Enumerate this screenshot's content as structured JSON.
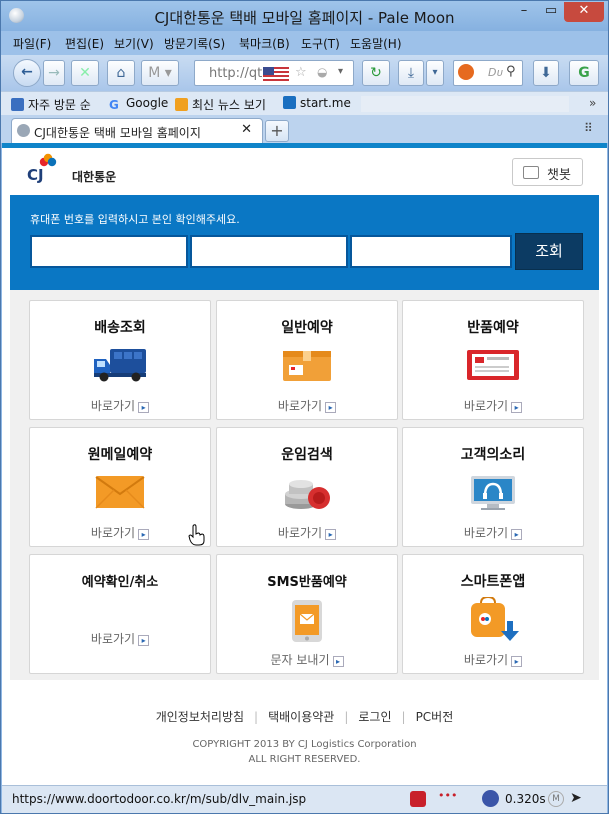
{
  "window": {
    "title": "CJ대한통운 택배 모바일 홈페이지 - Pale Moon"
  },
  "menubar": {
    "items": [
      "파일(F)",
      "편집(E)",
      "보기(V)",
      "방문기록(S)",
      "북마크(B)",
      "도구(T)",
      "도움말(H)"
    ]
  },
  "navbar": {
    "url": "http://qt",
    "search_placeholder": "Dᴜ"
  },
  "bookmarks": {
    "items": [
      "자주 방문 순",
      "Google",
      "최신 뉴스 보기",
      "start.me"
    ]
  },
  "tab": {
    "label": "CJ대한통운 택배 모바일 홈페이지",
    "new_tab": "+"
  },
  "site": {
    "logo_cj": "CJ",
    "logo_name": "대한통운",
    "chatbot_label": "챗봇",
    "lookup_hint": "휴대폰 번호를 입력하시고 본인 확인해주세요.",
    "lookup_button": "조회"
  },
  "cards": [
    {
      "title": "배송조회",
      "link": "바로가기",
      "icon": "delivery-truck-icon"
    },
    {
      "title": "일반예약",
      "link": "바로가기",
      "icon": "parcel-box-icon"
    },
    {
      "title": "반품예약",
      "link": "바로가기",
      "icon": "return-receipt-icon"
    },
    {
      "title": "원메일예약",
      "link": "바로가기",
      "icon": "envelope-icon"
    },
    {
      "title": "운임검색",
      "link": "바로가기",
      "icon": "coins-icon"
    },
    {
      "title": "고객의소리",
      "link": "바로가기",
      "icon": "customer-voice-monitor-icon"
    },
    {
      "title": "예약확인/취소",
      "link": "바로가기",
      "icon": ""
    },
    {
      "title": "SMS반품예약",
      "link": "문자 보내기",
      "icon": "mobile-message-icon"
    },
    {
      "title": "스마트폰앱",
      "link": "바로가기",
      "icon": "app-download-icon"
    }
  ],
  "footer": {
    "links": [
      "개인정보처리방침",
      "택배이용약관",
      "로그인",
      "PC버전"
    ],
    "copyright_1": "COPYRIGHT 2013 BY CJ Logistics Corporation",
    "copyright_2": "ALL RIGHT RESERVED."
  },
  "statusbar": {
    "url": "https://www.doortodoor.co.kr/m/sub/dlv_main.jsp",
    "timing": "0.320s"
  },
  "colors": {
    "accent": "#0a77c4",
    "button": "#0c3b63",
    "brand_orange": "#f39200"
  }
}
